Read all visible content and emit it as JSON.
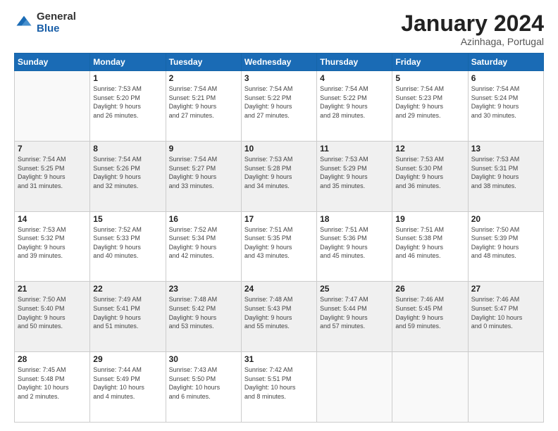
{
  "logo": {
    "general": "General",
    "blue": "Blue"
  },
  "header": {
    "month": "January 2024",
    "location": "Azinhaga, Portugal"
  },
  "weekdays": [
    "Sunday",
    "Monday",
    "Tuesday",
    "Wednesday",
    "Thursday",
    "Friday",
    "Saturday"
  ],
  "weeks": [
    [
      {
        "day": "",
        "info": ""
      },
      {
        "day": "1",
        "info": "Sunrise: 7:53 AM\nSunset: 5:20 PM\nDaylight: 9 hours\nand 26 minutes."
      },
      {
        "day": "2",
        "info": "Sunrise: 7:54 AM\nSunset: 5:21 PM\nDaylight: 9 hours\nand 27 minutes."
      },
      {
        "day": "3",
        "info": "Sunrise: 7:54 AM\nSunset: 5:22 PM\nDaylight: 9 hours\nand 27 minutes."
      },
      {
        "day": "4",
        "info": "Sunrise: 7:54 AM\nSunset: 5:22 PM\nDaylight: 9 hours\nand 28 minutes."
      },
      {
        "day": "5",
        "info": "Sunrise: 7:54 AM\nSunset: 5:23 PM\nDaylight: 9 hours\nand 29 minutes."
      },
      {
        "day": "6",
        "info": "Sunrise: 7:54 AM\nSunset: 5:24 PM\nDaylight: 9 hours\nand 30 minutes."
      }
    ],
    [
      {
        "day": "7",
        "info": "Sunrise: 7:54 AM\nSunset: 5:25 PM\nDaylight: 9 hours\nand 31 minutes."
      },
      {
        "day": "8",
        "info": "Sunrise: 7:54 AM\nSunset: 5:26 PM\nDaylight: 9 hours\nand 32 minutes."
      },
      {
        "day": "9",
        "info": "Sunrise: 7:54 AM\nSunset: 5:27 PM\nDaylight: 9 hours\nand 33 minutes."
      },
      {
        "day": "10",
        "info": "Sunrise: 7:53 AM\nSunset: 5:28 PM\nDaylight: 9 hours\nand 34 minutes."
      },
      {
        "day": "11",
        "info": "Sunrise: 7:53 AM\nSunset: 5:29 PM\nDaylight: 9 hours\nand 35 minutes."
      },
      {
        "day": "12",
        "info": "Sunrise: 7:53 AM\nSunset: 5:30 PM\nDaylight: 9 hours\nand 36 minutes."
      },
      {
        "day": "13",
        "info": "Sunrise: 7:53 AM\nSunset: 5:31 PM\nDaylight: 9 hours\nand 38 minutes."
      }
    ],
    [
      {
        "day": "14",
        "info": "Sunrise: 7:53 AM\nSunset: 5:32 PM\nDaylight: 9 hours\nand 39 minutes."
      },
      {
        "day": "15",
        "info": "Sunrise: 7:52 AM\nSunset: 5:33 PM\nDaylight: 9 hours\nand 40 minutes."
      },
      {
        "day": "16",
        "info": "Sunrise: 7:52 AM\nSunset: 5:34 PM\nDaylight: 9 hours\nand 42 minutes."
      },
      {
        "day": "17",
        "info": "Sunrise: 7:51 AM\nSunset: 5:35 PM\nDaylight: 9 hours\nand 43 minutes."
      },
      {
        "day": "18",
        "info": "Sunrise: 7:51 AM\nSunset: 5:36 PM\nDaylight: 9 hours\nand 45 minutes."
      },
      {
        "day": "19",
        "info": "Sunrise: 7:51 AM\nSunset: 5:38 PM\nDaylight: 9 hours\nand 46 minutes."
      },
      {
        "day": "20",
        "info": "Sunrise: 7:50 AM\nSunset: 5:39 PM\nDaylight: 9 hours\nand 48 minutes."
      }
    ],
    [
      {
        "day": "21",
        "info": "Sunrise: 7:50 AM\nSunset: 5:40 PM\nDaylight: 9 hours\nand 50 minutes."
      },
      {
        "day": "22",
        "info": "Sunrise: 7:49 AM\nSunset: 5:41 PM\nDaylight: 9 hours\nand 51 minutes."
      },
      {
        "day": "23",
        "info": "Sunrise: 7:48 AM\nSunset: 5:42 PM\nDaylight: 9 hours\nand 53 minutes."
      },
      {
        "day": "24",
        "info": "Sunrise: 7:48 AM\nSunset: 5:43 PM\nDaylight: 9 hours\nand 55 minutes."
      },
      {
        "day": "25",
        "info": "Sunrise: 7:47 AM\nSunset: 5:44 PM\nDaylight: 9 hours\nand 57 minutes."
      },
      {
        "day": "26",
        "info": "Sunrise: 7:46 AM\nSunset: 5:45 PM\nDaylight: 9 hours\nand 59 minutes."
      },
      {
        "day": "27",
        "info": "Sunrise: 7:46 AM\nSunset: 5:47 PM\nDaylight: 10 hours\nand 0 minutes."
      }
    ],
    [
      {
        "day": "28",
        "info": "Sunrise: 7:45 AM\nSunset: 5:48 PM\nDaylight: 10 hours\nand 2 minutes."
      },
      {
        "day": "29",
        "info": "Sunrise: 7:44 AM\nSunset: 5:49 PM\nDaylight: 10 hours\nand 4 minutes."
      },
      {
        "day": "30",
        "info": "Sunrise: 7:43 AM\nSunset: 5:50 PM\nDaylight: 10 hours\nand 6 minutes."
      },
      {
        "day": "31",
        "info": "Sunrise: 7:42 AM\nSunset: 5:51 PM\nDaylight: 10 hours\nand 8 minutes."
      },
      {
        "day": "",
        "info": ""
      },
      {
        "day": "",
        "info": ""
      },
      {
        "day": "",
        "info": ""
      }
    ]
  ]
}
